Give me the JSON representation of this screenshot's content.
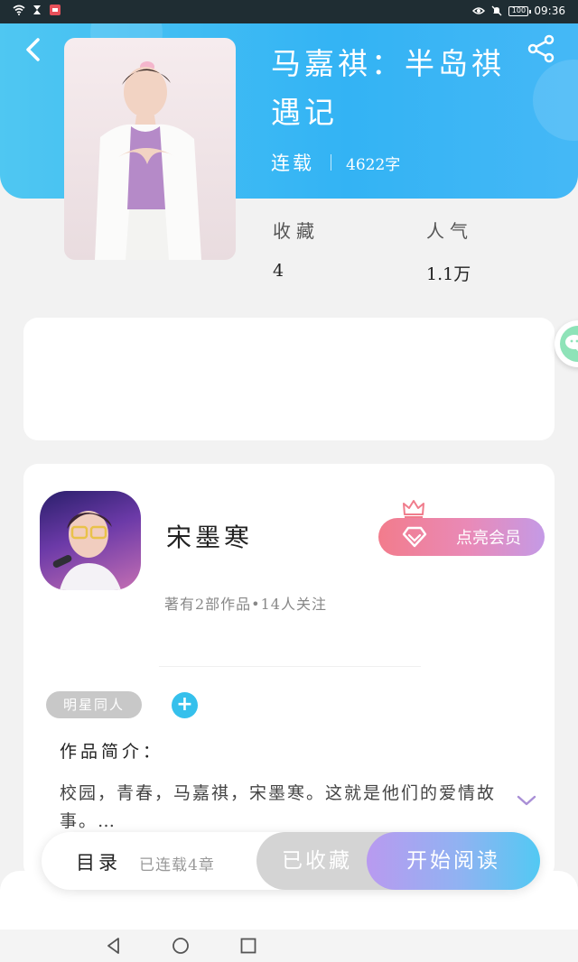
{
  "status_bar": {
    "time": "09:36",
    "battery": "100"
  },
  "book": {
    "title": "马嘉祺：半岛祺遇记",
    "status": "连载",
    "word_count": "4622字",
    "favorites_label": "收藏",
    "favorites_value": "4",
    "popularity_label": "人气",
    "popularity_value": "1.1万"
  },
  "author": {
    "name": "宋墨寒",
    "meta": "著有2部作品•14人关注",
    "vip_button": "点亮会员"
  },
  "tags": [
    "明星同人"
  ],
  "intro": {
    "label": "作品简介：",
    "text": "校园，青春，马嘉祺，宋墨寒。这就是他们的爱情故事。…"
  },
  "bottom_bar": {
    "toc_label": "目录",
    "chapters": "已连载4章",
    "collected_button": "已收藏",
    "read_button": "开始阅读"
  },
  "colors": {
    "header": "#33b3f4",
    "accent": "#35c0ec",
    "vip": "#f27c8c"
  },
  "icons": [
    "back-icon",
    "share-icon",
    "wechat-icon",
    "crown-icon",
    "diamond-icon",
    "plus-icon",
    "chevron-down-icon"
  ]
}
